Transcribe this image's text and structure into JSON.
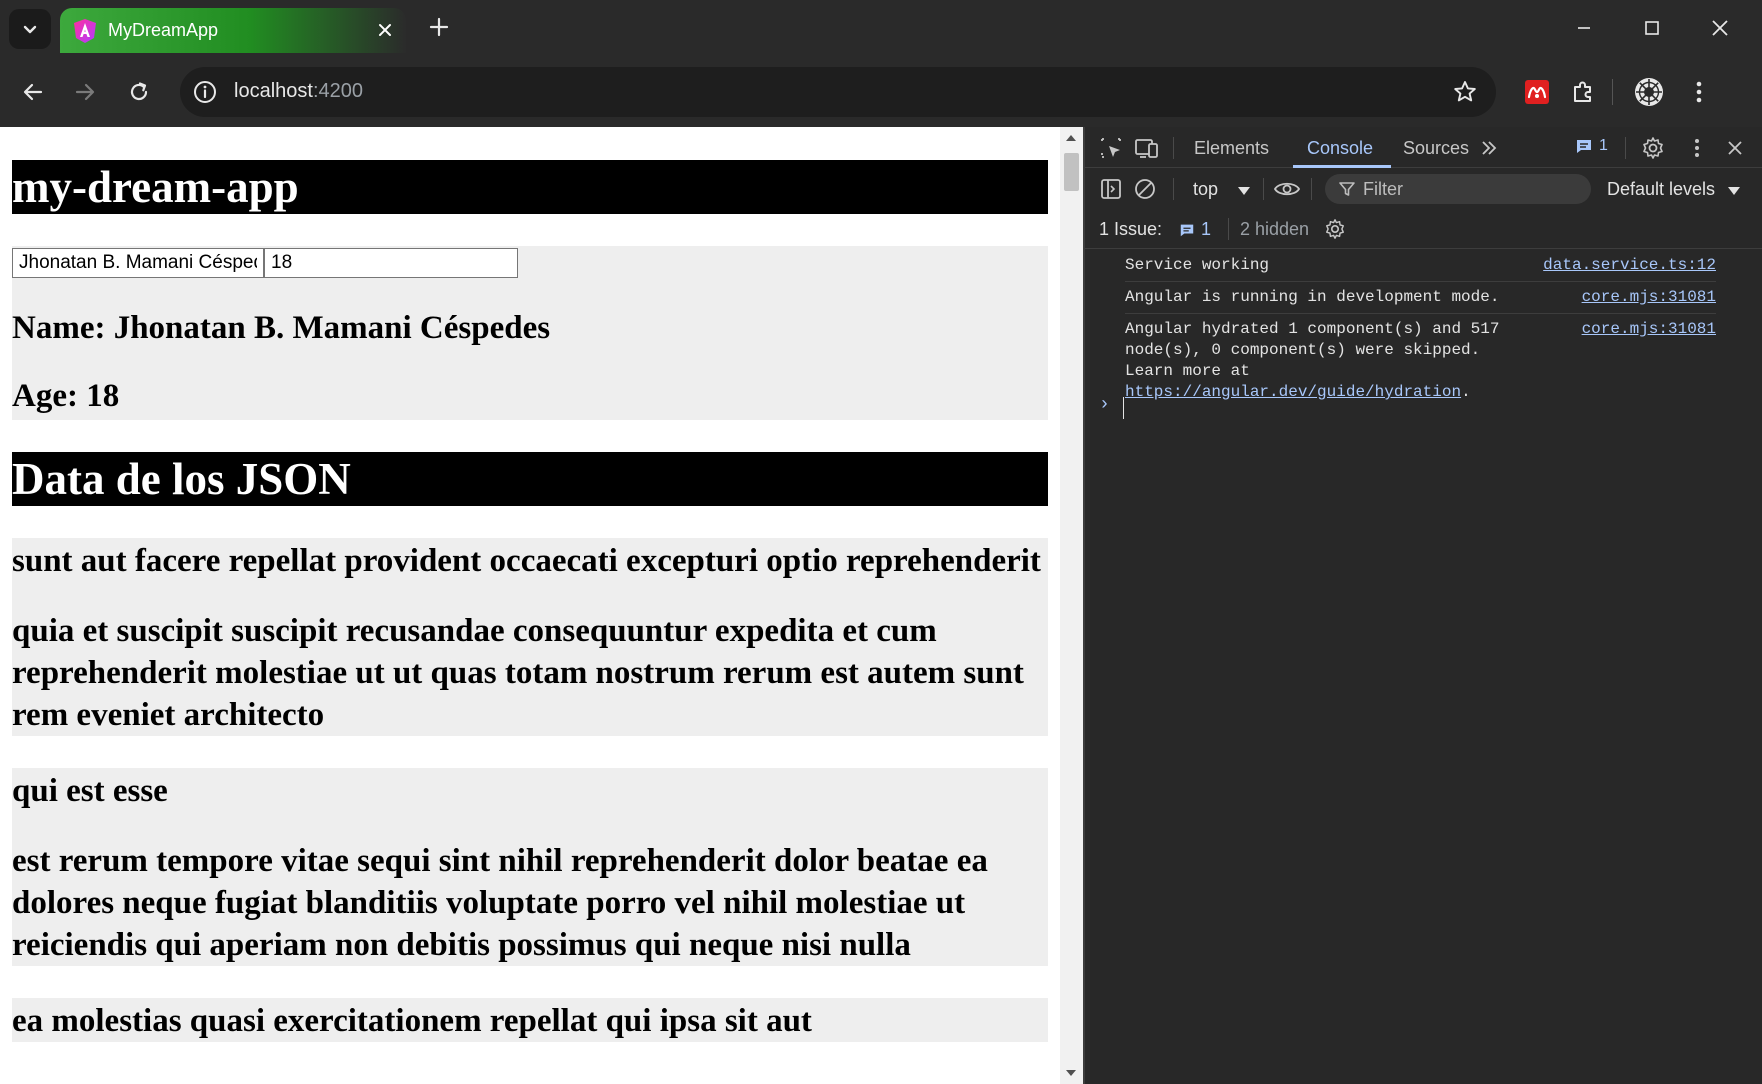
{
  "browser": {
    "tab_title": "MyDreamApp",
    "url_host": "localhost",
    "url_port": ":4200",
    "colors": {
      "tab_green": "#2b9a2b",
      "chrome_bg": "#2a2a2a"
    }
  },
  "page": {
    "heading": "my-dream-app",
    "name_input_value": "Jhonatan B. Mamani Céspedes",
    "age_input_value": "18",
    "name_line": "Name: Jhonatan B. Mamani Céspedes",
    "age_line": "Age: 18",
    "json_heading": "Data de los JSON",
    "posts": [
      {
        "title": "sunt aut facere repellat provident occaecati excepturi optio reprehenderit",
        "body": "quia et suscipit suscipit recusandae consequuntur expedita et cum reprehenderit molestiae ut ut quas totam nostrum rerum est autem sunt rem eveniet architecto"
      },
      {
        "title": "qui est esse",
        "body": "est rerum tempore vitae sequi sint nihil reprehenderit dolor beatae ea dolores neque fugiat blanditiis voluptate porro vel nihil molestiae ut reiciendis qui aperiam non debitis possimus qui neque nisi nulla"
      },
      {
        "title": "ea molestias quasi exercitationem repellat qui ipsa sit aut"
      }
    ]
  },
  "devtools": {
    "tabs": [
      "Elements",
      "Console",
      "Sources"
    ],
    "badge_count": "1",
    "context": "top",
    "filter_placeholder": "Filter",
    "levels": "Default levels",
    "issues_label": "1 Issue:",
    "issues_count": "1",
    "hidden_label": "2 hidden",
    "messages": [
      {
        "text": "Service working",
        "source": "data.service.ts:12"
      },
      {
        "text": "Angular is running in development mode.",
        "source": "core.mjs:31081"
      },
      {
        "text": "Angular hydrated 1 component(s) and 517 node(s), 0 component(s) were skipped. Learn more at ",
        "link": "https://angular.dev/guide/hydration",
        "tail": ".",
        "source": "core.mjs:31081"
      }
    ],
    "prompt": "›"
  }
}
